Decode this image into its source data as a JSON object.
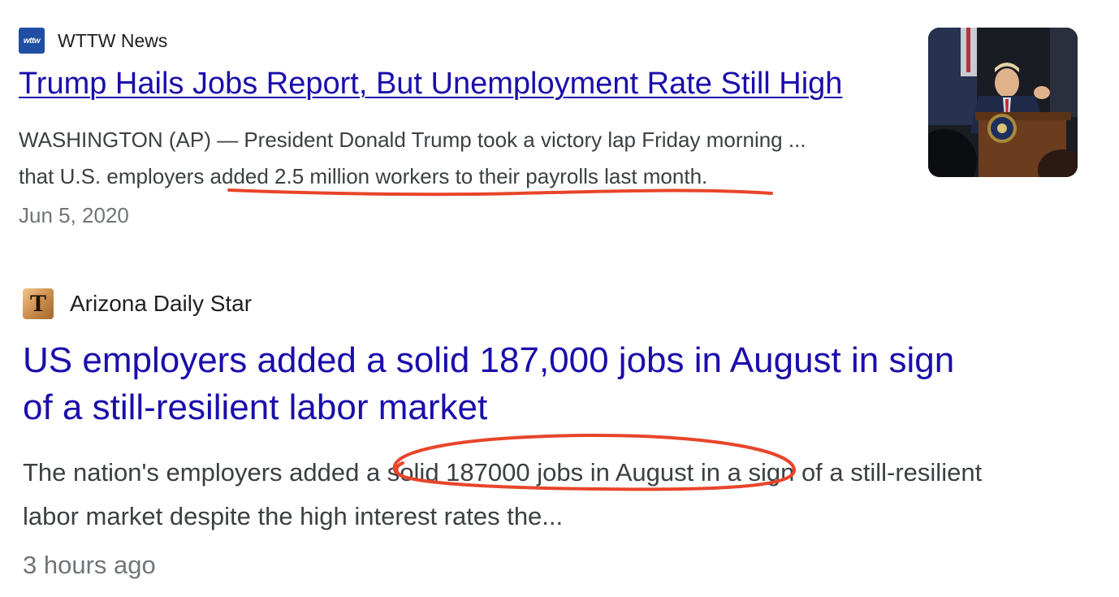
{
  "results": [
    {
      "source": "WTTW News",
      "favicon_text": "wttw",
      "headline": "Trump Hails Jobs Report, But Unemployment Rate Still High",
      "snippet_line1": "WASHINGTON (AP) — President Donald Trump took a victory lap Friday morning ...",
      "snippet_line2": "that U.S. employers added 2.5 million workers to their payrolls last month.",
      "date": "Jun 5, 2020",
      "has_thumbnail": true
    },
    {
      "source": "Arizona Daily Star",
      "favicon_text": "T",
      "headline_line1": "US employers added a solid 187,000 jobs in August in sign",
      "headline_line2": "of a still-resilient labor market",
      "snippet_line1": "The nation's employers added a solid 187000 jobs in August in a sign of a still-resilient",
      "snippet_line2": "labor market despite the high interest rates the...",
      "date": "3 hours ago"
    }
  ],
  "colors": {
    "link": "#1a0dab",
    "annotation": "#e8452a",
    "snippet": "#3c4043",
    "date": "#70757a"
  }
}
